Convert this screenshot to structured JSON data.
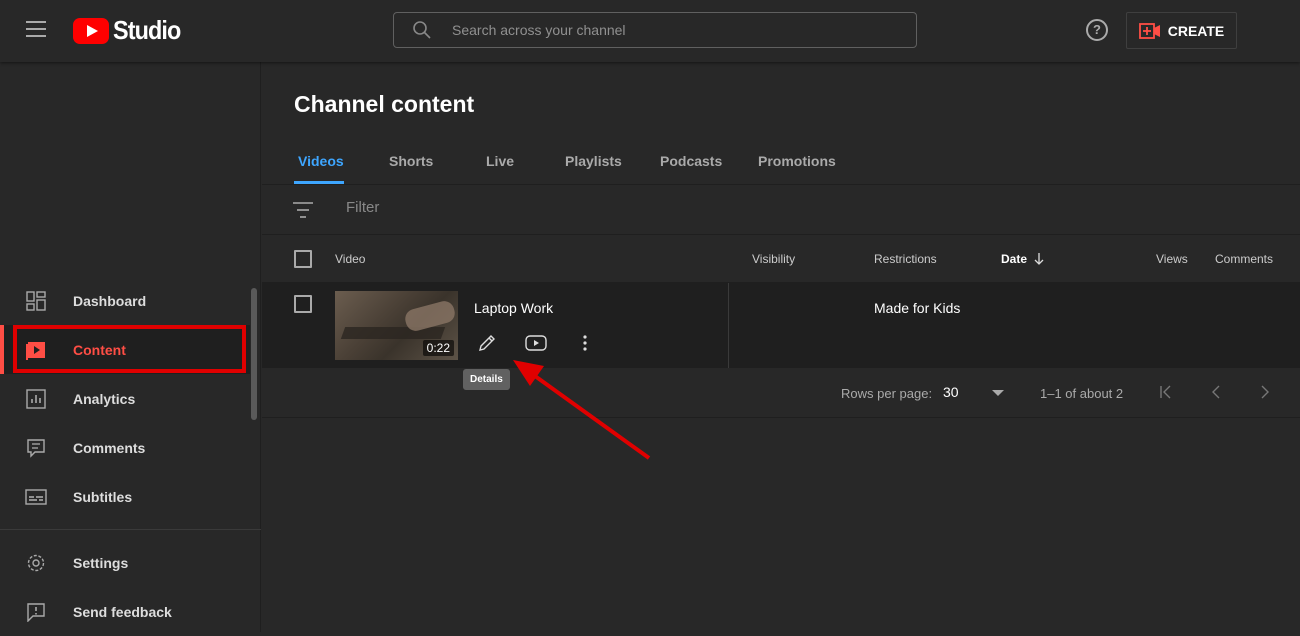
{
  "topbar": {
    "logo_text": "Studio",
    "search_placeholder": "Search across your channel",
    "help_label": "?",
    "create_label": "CREATE"
  },
  "sidebar": {
    "items": [
      {
        "label": "Dashboard",
        "icon": "dashboard-icon"
      },
      {
        "label": "Content",
        "icon": "content-icon",
        "active": true
      },
      {
        "label": "Analytics",
        "icon": "analytics-icon"
      },
      {
        "label": "Comments",
        "icon": "comments-icon"
      },
      {
        "label": "Subtitles",
        "icon": "subtitles-icon"
      },
      {
        "label": "Settings",
        "icon": "settings-icon"
      },
      {
        "label": "Send feedback",
        "icon": "feedback-icon"
      }
    ]
  },
  "main": {
    "title": "Channel content",
    "tabs": [
      {
        "label": "Videos",
        "active": true
      },
      {
        "label": "Shorts"
      },
      {
        "label": "Live"
      },
      {
        "label": "Playlists"
      },
      {
        "label": "Podcasts"
      },
      {
        "label": "Promotions"
      }
    ],
    "filter_placeholder": "Filter",
    "columns": {
      "video": "Video",
      "visibility": "Visibility",
      "restrictions": "Restrictions",
      "date": "Date",
      "views": "Views",
      "comments": "Comments"
    },
    "rows": [
      {
        "title": "Laptop Work",
        "duration": "0:22",
        "visibility": "",
        "restrictions": "Made for Kids",
        "date": "",
        "views": "",
        "comments": ""
      }
    ],
    "tooltip": "Details",
    "pagination": {
      "rows_per_page_label": "Rows per page:",
      "rows_per_page_value": "30",
      "range_label": "1–1 of about 2"
    }
  },
  "colors": {
    "accent_blue": "#3ea6ff",
    "youtube_red": "#ff0000",
    "active_red": "#ff4e45",
    "annotation_red": "#e00000"
  }
}
